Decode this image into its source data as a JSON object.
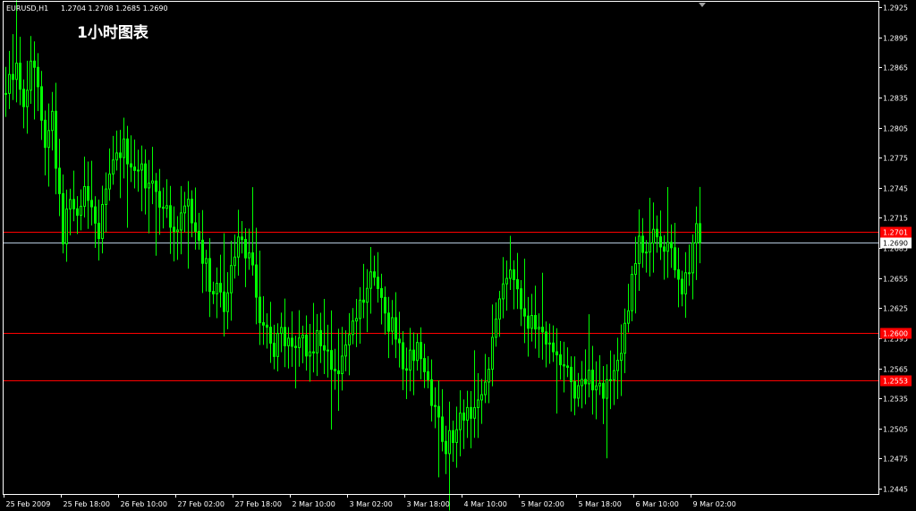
{
  "header": {
    "symbol": "EURUSD,H1",
    "ohlc": "1.2704 1.2708 1.2685 1.2690"
  },
  "overlay_title": "1小时图表",
  "colors": {
    "background": "#000000",
    "candle": "#00ff00",
    "frame": "#ffffff",
    "level_line": "#ff0000",
    "level_label_bg": "#ff0000",
    "bid_line": "#b4c8dc",
    "bid_label_bg": "#ffffff",
    "bid_label_text": "#000000"
  },
  "chart_data": {
    "type": "candlestick",
    "symbol": "EURUSD",
    "timeframe": "H1",
    "ylim": [
      1.2435,
      1.2935
    ],
    "y_ticks": [
      "1.2925",
      "1.2895",
      "1.2865",
      "1.2835",
      "1.2805",
      "1.2775",
      "1.2745",
      "1.2715",
      "1.2685",
      "1.2655",
      "1.2625",
      "1.2595",
      "1.2565",
      "1.2535",
      "1.2505",
      "1.2475",
      "1.2445"
    ],
    "x_ticks": [
      "25 Feb 2009",
      "25 Feb 18:00",
      "26 Feb 10:00",
      "27 Feb 02:00",
      "27 Feb 18:00",
      "2 Mar 10:00",
      "3 Mar 02:00",
      "3 Mar 18:00",
      "4 Mar 10:00",
      "5 Mar 02:00",
      "5 Mar 18:00",
      "6 Mar 10:00",
      "9 Mar 02:00"
    ],
    "x_tick_positions": [
      0,
      16,
      32,
      48,
      64,
      80,
      96,
      112,
      128,
      144,
      160,
      176,
      192
    ],
    "levels": [
      {
        "label": "1.2701",
        "value": 1.2701
      },
      {
        "label": "1.2600",
        "value": 1.26
      },
      {
        "label": "1.2553",
        "value": 1.2553
      }
    ],
    "bid": {
      "label": "1.2690",
      "value": 1.269
    },
    "path": [
      [
        0,
        1.285
      ],
      [
        3,
        1.286
      ],
      [
        5,
        1.2815
      ],
      [
        7,
        1.288
      ],
      [
        9,
        1.284
      ],
      [
        11,
        1.279
      ],
      [
        13,
        1.282
      ],
      [
        15,
        1.273
      ],
      [
        16,
        1.27
      ],
      [
        18,
        1.274
      ],
      [
        20,
        1.272
      ],
      [
        22,
        1.2745
      ],
      [
        24,
        1.272
      ],
      [
        26,
        1.2705
      ],
      [
        28,
        1.274
      ],
      [
        30,
        1.277
      ],
      [
        33,
        1.279
      ],
      [
        35,
        1.2765
      ],
      [
        37,
        1.277
      ],
      [
        39,
        1.2755
      ],
      [
        41,
        1.275
      ],
      [
        43,
        1.273
      ],
      [
        45,
        1.272
      ],
      [
        47,
        1.2705
      ],
      [
        49,
        1.2715
      ],
      [
        51,
        1.2725
      ],
      [
        53,
        1.2705
      ],
      [
        55,
        1.268
      ],
      [
        57,
        1.265
      ],
      [
        59,
        1.264
      ],
      [
        61,
        1.263
      ],
      [
        63,
        1.267
      ],
      [
        65,
        1.27
      ],
      [
        67,
        1.268
      ],
      [
        69,
        1.266
      ],
      [
        71,
        1.262
      ],
      [
        73,
        1.26
      ],
      [
        75,
        1.258
      ],
      [
        77,
        1.26
      ],
      [
        79,
        1.259
      ],
      [
        81,
        1.2595
      ],
      [
        83,
        1.259
      ],
      [
        85,
        1.258
      ],
      [
        87,
        1.26
      ],
      [
        89,
        1.258
      ],
      [
        91,
        1.257
      ],
      [
        93,
        1.257
      ],
      [
        95,
        1.258
      ],
      [
        97,
        1.261
      ],
      [
        99,
        1.2625
      ],
      [
        101,
        1.2645
      ],
      [
        103,
        1.266
      ],
      [
        105,
        1.264
      ],
      [
        107,
        1.261
      ],
      [
        109,
        1.26
      ],
      [
        111,
        1.257
      ],
      [
        113,
        1.2575
      ],
      [
        115,
        1.258
      ],
      [
        117,
        1.256
      ],
      [
        119,
        1.253
      ],
      [
        121,
        1.251
      ],
      [
        123,
        1.249
      ],
      [
        125,
        1.25
      ],
      [
        127,
        1.2515
      ],
      [
        129,
        1.2525
      ],
      [
        131,
        1.252
      ],
      [
        133,
        1.254
      ],
      [
        135,
        1.257
      ],
      [
        137,
        1.261
      ],
      [
        139,
        1.264
      ],
      [
        141,
        1.266
      ],
      [
        143,
        1.264
      ],
      [
        145,
        1.2615
      ],
      [
        147,
        1.261
      ],
      [
        149,
        1.2605
      ],
      [
        151,
        1.26
      ],
      [
        153,
        1.259
      ],
      [
        155,
        1.2575
      ],
      [
        157,
        1.256
      ],
      [
        159,
        1.254
      ],
      [
        161,
        1.2545
      ],
      [
        163,
        1.2555
      ],
      [
        165,
        1.2545
      ],
      [
        167,
        1.254
      ],
      [
        169,
        1.255
      ],
      [
        171,
        1.257
      ],
      [
        173,
        1.26
      ],
      [
        175,
        1.266
      ],
      [
        177,
        1.269
      ],
      [
        179,
        1.2685
      ],
      [
        181,
        1.27
      ],
      [
        183,
        1.269
      ],
      [
        185,
        1.268
      ],
      [
        187,
        1.267
      ],
      [
        189,
        1.2645
      ],
      [
        191,
        1.267
      ],
      [
        193,
        1.27
      ],
      [
        195,
        1.269
      ]
    ],
    "wick_min": 0.0008,
    "wick_max": 0.003
  }
}
